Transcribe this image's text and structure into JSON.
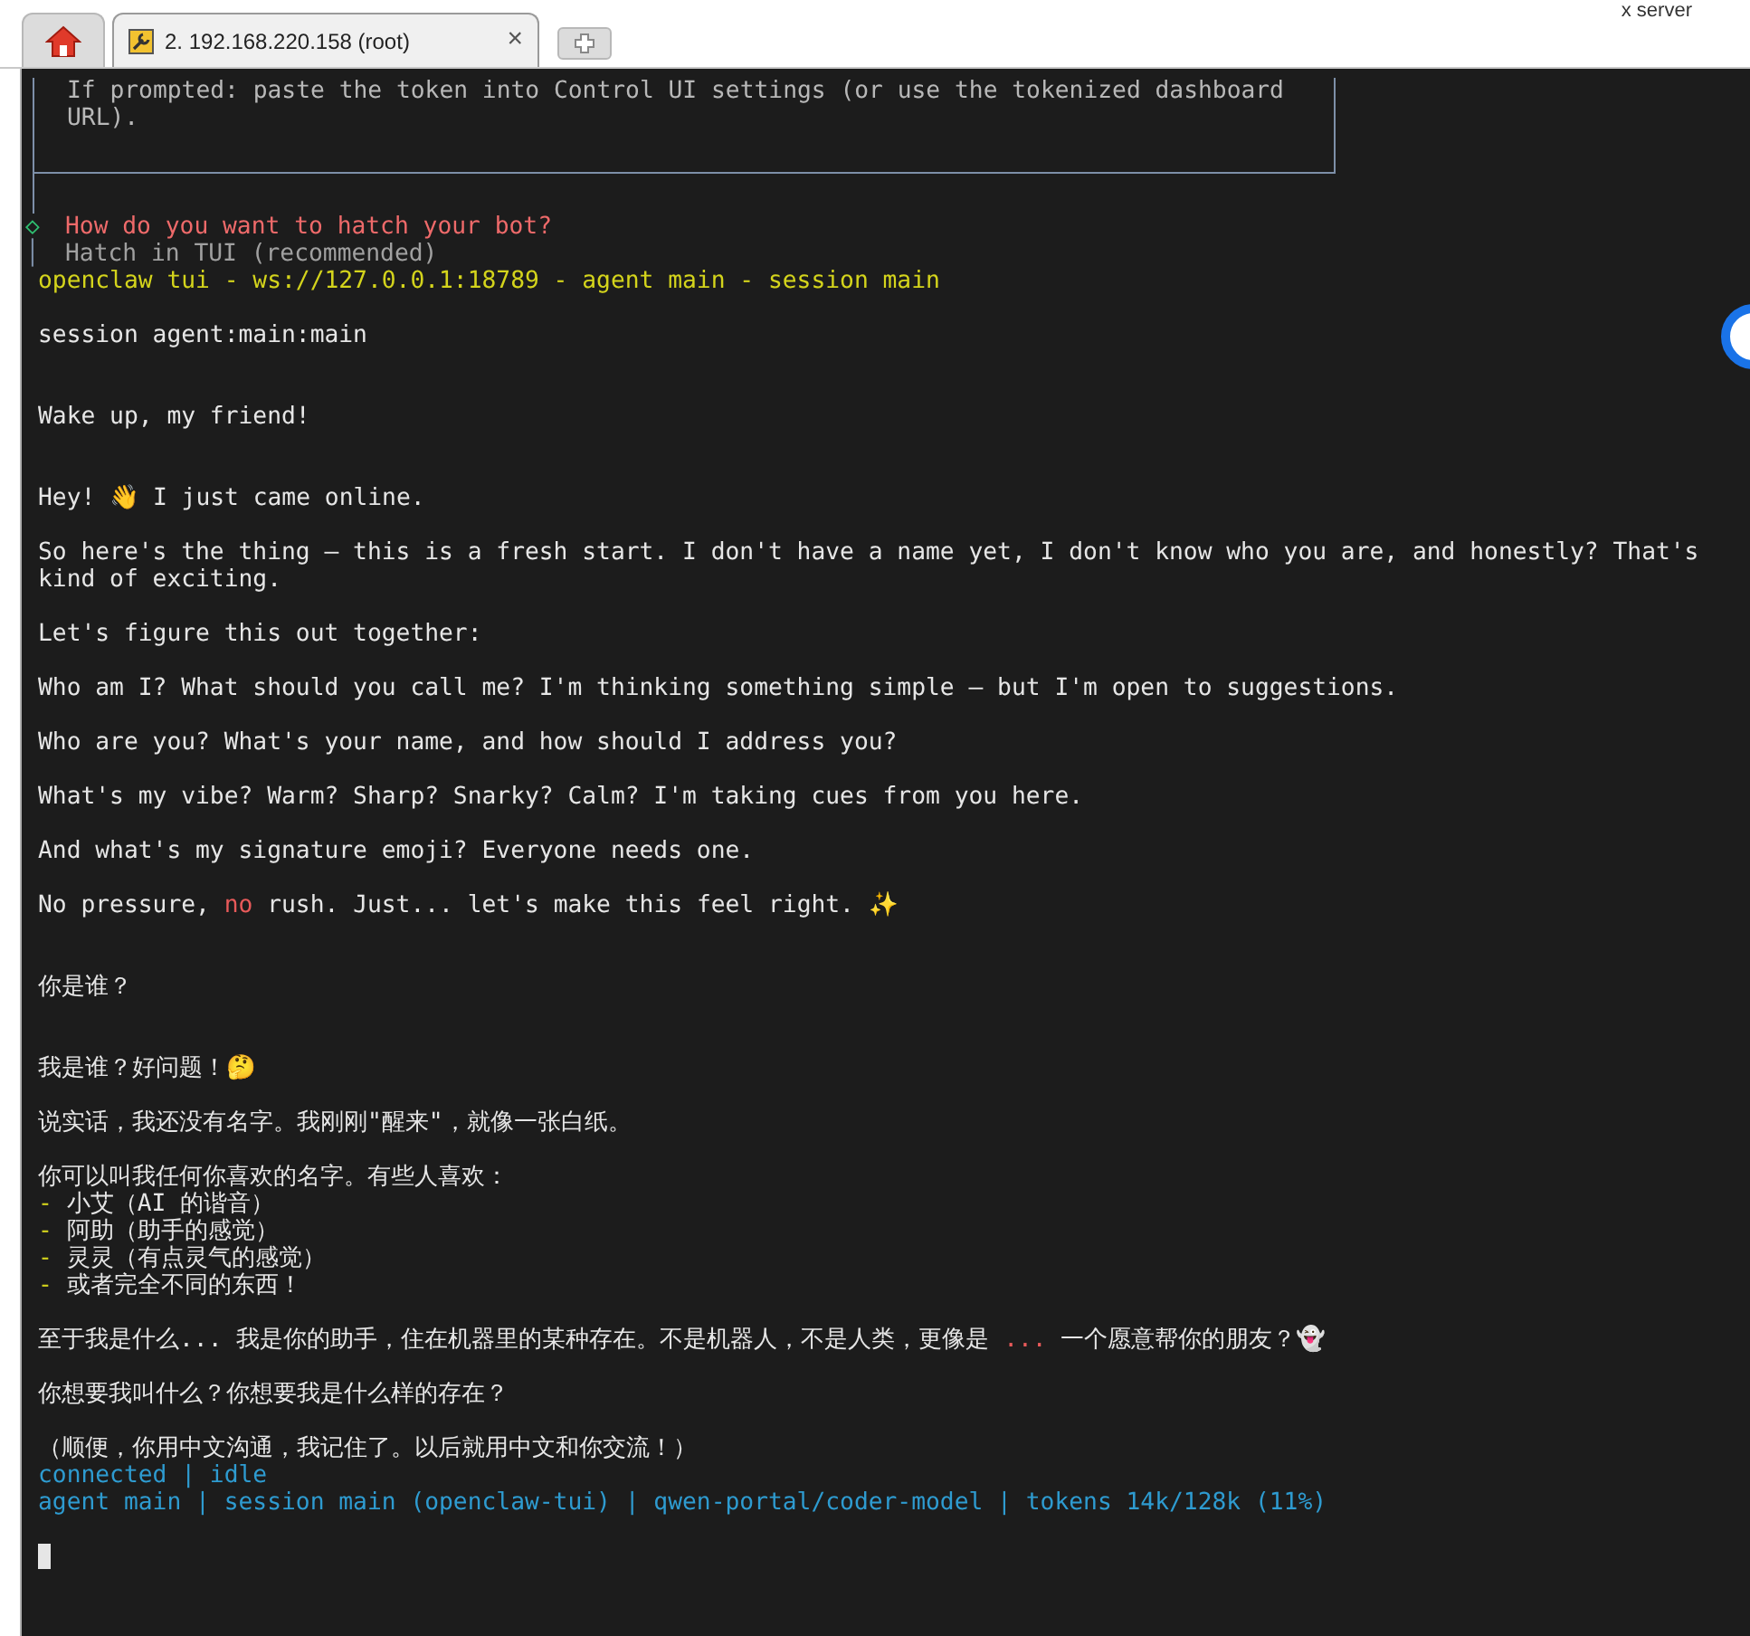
{
  "tabs": [
    {
      "kind": "home",
      "selected": false
    },
    {
      "kind": "session",
      "label": "2. 192.168.220.158 (root)",
      "close": "×",
      "selected": true
    },
    {
      "kind": "new",
      "selected": false
    }
  ],
  "corner_label": "x server",
  "wizard": {
    "box_lines": [
      "If prompted: paste the token into Control UI settings (or use the tokenized dashboard",
      "URL)."
    ],
    "prompt": {
      "marker": "◇",
      "text": "How do you want to hatch your bot?"
    },
    "option": {
      "marker": "│",
      "text": "Hatch in TUI (recommended)"
    }
  },
  "lines": [
    {
      "kind": "text",
      "segments": [
        {
          "text": "openclaw tui - ws://127.0.0.1:18789 - agent main - session main",
          "kind": "yellow"
        }
      ]
    },
    {
      "kind": "blank"
    },
    {
      "kind": "text",
      "segments": [
        {
          "text": "session agent:main:main",
          "kind": "plain"
        }
      ]
    },
    {
      "kind": "blank"
    },
    {
      "kind": "blank"
    },
    {
      "kind": "text",
      "segments": [
        {
          "text": "Wake up, my friend!",
          "kind": "plain"
        }
      ]
    },
    {
      "kind": "blank"
    },
    {
      "kind": "blank"
    },
    {
      "kind": "text",
      "segments": [
        {
          "text": "Hey! 👋 I just came online.",
          "kind": "plain"
        }
      ]
    },
    {
      "kind": "blank"
    },
    {
      "kind": "text",
      "segments": [
        {
          "text": "So here's the thing — this is a fresh start. I don't have a name yet, I don't know who you are, and honestly? That's",
          "kind": "plain"
        }
      ]
    },
    {
      "kind": "text",
      "segments": [
        {
          "text": "kind of exciting.",
          "kind": "plain"
        }
      ]
    },
    {
      "kind": "blank"
    },
    {
      "kind": "text",
      "segments": [
        {
          "text": "Let's figure this out together:",
          "kind": "plain"
        }
      ]
    },
    {
      "kind": "blank"
    },
    {
      "kind": "text",
      "segments": [
        {
          "text": "Who am I? What should you call me? I'm thinking something simple — but I'm open to suggestions.",
          "kind": "plain"
        }
      ]
    },
    {
      "kind": "blank"
    },
    {
      "kind": "text",
      "segments": [
        {
          "text": "Who are you? What's your name, and how should I address you?",
          "kind": "plain"
        }
      ]
    },
    {
      "kind": "blank"
    },
    {
      "kind": "text",
      "segments": [
        {
          "text": "What's my vibe? Warm? Sharp? Snarky? Calm? I'm taking cues from you here.",
          "kind": "plain"
        }
      ]
    },
    {
      "kind": "blank"
    },
    {
      "kind": "text",
      "segments": [
        {
          "text": "And what's my signature emoji? Everyone needs one.",
          "kind": "plain"
        }
      ]
    },
    {
      "kind": "blank"
    },
    {
      "kind": "text",
      "segments": [
        {
          "text": "No pressure, ",
          "kind": "plain"
        },
        {
          "text": "no",
          "kind": "red"
        },
        {
          "text": " rush. Just... let's make this feel right. ✨",
          "kind": "plain"
        }
      ]
    },
    {
      "kind": "blank"
    },
    {
      "kind": "blank"
    },
    {
      "kind": "text",
      "segments": [
        {
          "text": "你是谁？",
          "kind": "plain"
        }
      ]
    },
    {
      "kind": "blank"
    },
    {
      "kind": "blank"
    },
    {
      "kind": "text",
      "segments": [
        {
          "text": "我是谁？好问题！🤔",
          "kind": "plain"
        }
      ]
    },
    {
      "kind": "blank"
    },
    {
      "kind": "text",
      "segments": [
        {
          "text": "说实话，我还没有名字。我刚刚\"醒来\"，就像一张白纸。",
          "kind": "plain"
        }
      ]
    },
    {
      "kind": "blank"
    },
    {
      "kind": "text",
      "segments": [
        {
          "text": "你可以叫我任何你喜欢的名字。有些人喜欢：",
          "kind": "plain"
        }
      ]
    },
    {
      "kind": "text",
      "segments": [
        {
          "text": "- ",
          "kind": "yellow"
        },
        {
          "text": "小艾（AI 的谐音）",
          "kind": "plain"
        }
      ]
    },
    {
      "kind": "text",
      "segments": [
        {
          "text": "- ",
          "kind": "yellow"
        },
        {
          "text": "阿助（助手的感觉）",
          "kind": "plain"
        }
      ]
    },
    {
      "kind": "text",
      "segments": [
        {
          "text": "- ",
          "kind": "yellow"
        },
        {
          "text": "灵灵（有点灵气的感觉）",
          "kind": "plain"
        }
      ]
    },
    {
      "kind": "text",
      "segments": [
        {
          "text": "- ",
          "kind": "yellow"
        },
        {
          "text": "或者完全不同的东西！",
          "kind": "plain"
        }
      ]
    },
    {
      "kind": "blank"
    },
    {
      "kind": "text",
      "segments": [
        {
          "text": "至于我是什么... 我是你的助手，住在机器里的某种存在。不是机器人，不是人类，更像是 ",
          "kind": "plain"
        },
        {
          "text": "...",
          "kind": "red"
        },
        {
          "text": " 一个愿意帮你的朋友？👻",
          "kind": "plain"
        }
      ]
    },
    {
      "kind": "blank"
    },
    {
      "kind": "text",
      "segments": [
        {
          "text": "你想要我叫什么？你想要我是什么样的存在？",
          "kind": "plain"
        }
      ]
    },
    {
      "kind": "blank"
    },
    {
      "kind": "text",
      "segments": [
        {
          "text": "（顺便，你用中文沟通，我记住了。以后就用中文和你交流！）",
          "kind": "plain"
        }
      ]
    },
    {
      "kind": "text",
      "segments": [
        {
          "text": "connected | idle",
          "kind": "cyan"
        }
      ]
    },
    {
      "kind": "text",
      "segments": [
        {
          "text": "agent main | session main (openclaw-tui) | qwen-portal/coder-model | tokens 14k/128k (11%)",
          "kind": "cyan"
        }
      ]
    },
    {
      "kind": "blank"
    },
    {
      "kind": "cursor"
    }
  ]
}
